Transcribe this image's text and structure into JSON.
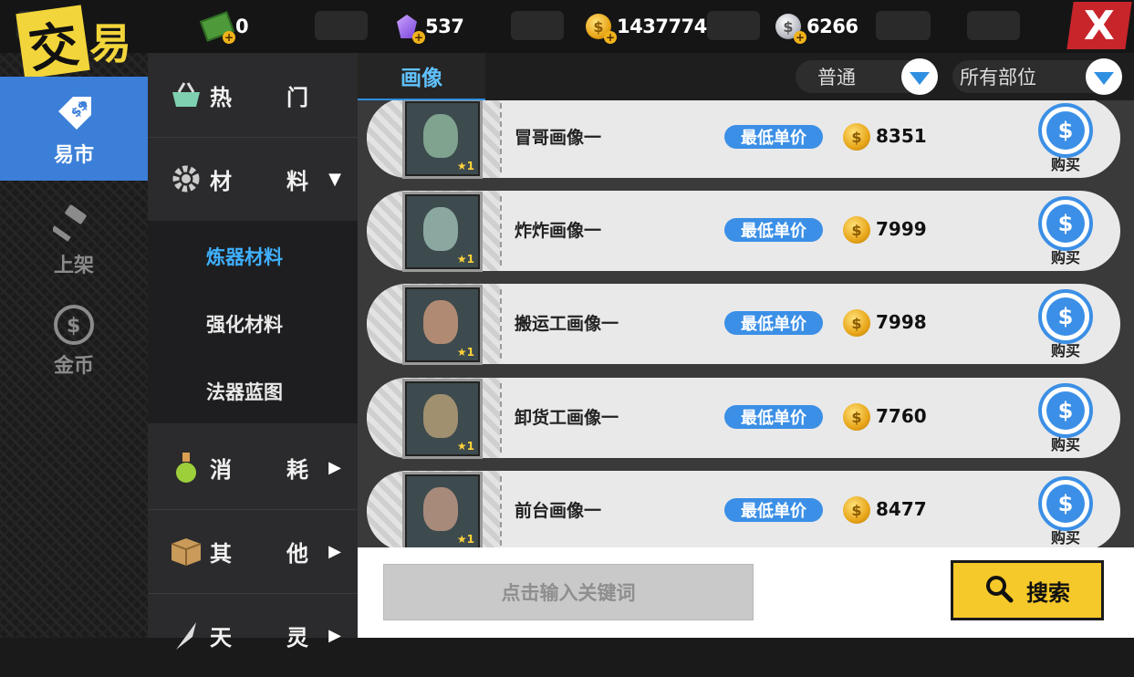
{
  "title": {
    "char1": "交",
    "char2": "易"
  },
  "currencies": [
    {
      "icon": "cash-icon",
      "value": "0"
    },
    {
      "icon": "crystal-icon",
      "value": "537"
    },
    {
      "icon": "gold-coin-icon",
      "value": "1437774"
    },
    {
      "icon": "silver-coin-icon",
      "value": "6266"
    }
  ],
  "close_label": "X",
  "rail": [
    {
      "label": "易市",
      "icon": "price-tag-icon",
      "active": true
    },
    {
      "label": "上架",
      "icon": "auction-hammer-icon",
      "active": false
    },
    {
      "label": "金币",
      "icon": "dollar-coin-icon",
      "active": false
    }
  ],
  "categories": {
    "hot": {
      "label": "热门",
      "icon": "basket-icon"
    },
    "materials": {
      "label": "材料",
      "icon": "gear-icon",
      "subs": [
        "炼器材料",
        "强化材料",
        "法器蓝图"
      ],
      "selected": "炼器材料"
    },
    "consumables": {
      "label": "消耗",
      "icon": "potion-icon"
    },
    "others": {
      "label": "其他",
      "icon": "box-icon"
    },
    "partial": {
      "label": "天灵",
      "icon": "blade-icon"
    }
  },
  "tab": {
    "label": "画像"
  },
  "filters": {
    "quality": "普通",
    "part": "所有部位"
  },
  "badge_label": "最低单价",
  "buy_label": "购买",
  "items": [
    {
      "name": "冒哥画像一",
      "price": "8351",
      "stars": "★1",
      "tint": "#7fa38e"
    },
    {
      "name": "炸炸画像一",
      "price": "7999",
      "stars": "★1",
      "tint": "#8aa8a0"
    },
    {
      "name": "搬运工画像一",
      "price": "7998",
      "stars": "★1",
      "tint": "#b08a72"
    },
    {
      "name": "卸货工画像一",
      "price": "7760",
      "stars": "★1",
      "tint": "#a09070"
    },
    {
      "name": "前台画像一",
      "price": "8477",
      "stars": "★1",
      "tint": "#a88a7a"
    }
  ],
  "search": {
    "placeholder": "点击输入关键词",
    "button": "搜索"
  },
  "colors": {
    "accent": "#3b8fe6",
    "highlight": "#f6c92a",
    "close": "#c8252b"
  }
}
